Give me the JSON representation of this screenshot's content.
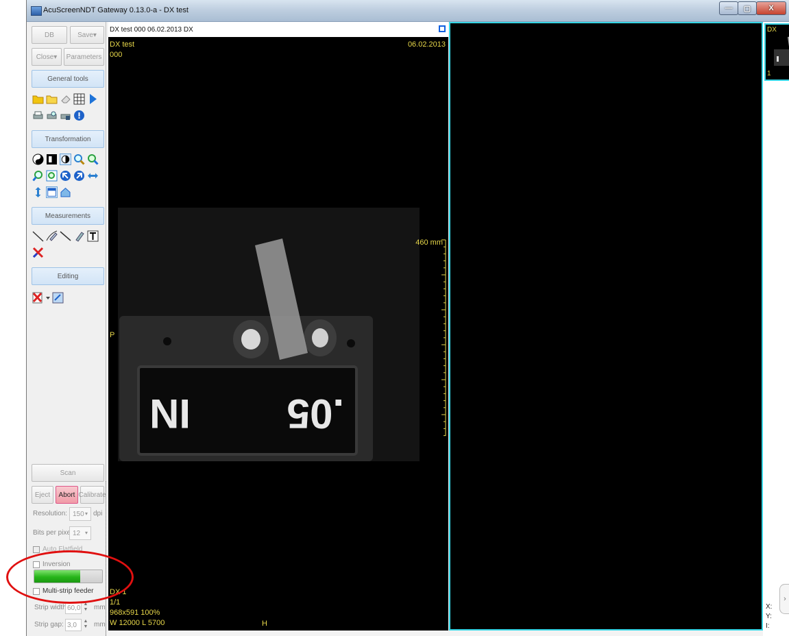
{
  "window": {
    "title": "AcuScreenNDT Gateway 0.13.0-a - DX test",
    "controls": {
      "minimize": "—",
      "maximize": "▢",
      "close": "X"
    }
  },
  "toolbar": {
    "db_label": "DB",
    "save_label": "Save▾",
    "close_label": "Close▾",
    "parameters_label": "Parameters"
  },
  "sections": {
    "general_tools": "General tools",
    "transformation": "Transformation",
    "measurements": "Measurements",
    "editing": "Editing"
  },
  "scan": {
    "scan_label": "Scan",
    "eject_label": "Eject",
    "abort_label": "Abort",
    "calibrate_label": "Calibrate",
    "resolution_label": "Resolution:",
    "resolution_value": "150",
    "resolution_unit": "dpi",
    "bits_label": "Bits per pixel:",
    "bits_value": "12",
    "auto_flat_label": "Auto Flatfield",
    "inversion_label": "Inversion",
    "progress_fraction": 0.68,
    "multi_strip_label": "Multi-strip feeder",
    "strip_width_label": "Strip width:",
    "strip_width_value": "60,0",
    "strip_gap_label": "Strip gap:",
    "strip_gap_value": "3,0",
    "unit_mm": "mm"
  },
  "viewer": {
    "header": "DX test  000  06.02.2013  DX",
    "overlay_name": "DX test",
    "overlay_id": "000",
    "overlay_date": "06.02.2013",
    "scale_label": "460 mm",
    "orientation_left": "P",
    "orientation_bottom": "H",
    "info_modality": "DX 1",
    "info_frames": "1/1",
    "info_size": "968x591 100%",
    "info_window": "W 12000 L 5700",
    "plate_text": "IN   .05"
  },
  "thumbnail": {
    "modality": "DX",
    "index": "1"
  },
  "coords": {
    "x": "X:",
    "y": "Y:",
    "i": "I:"
  },
  "colors": {
    "accent": "#36d6e6",
    "overlay_text": "#e8d84a",
    "abort_bg": "#f4b8c0",
    "progress": "#27b51a"
  }
}
